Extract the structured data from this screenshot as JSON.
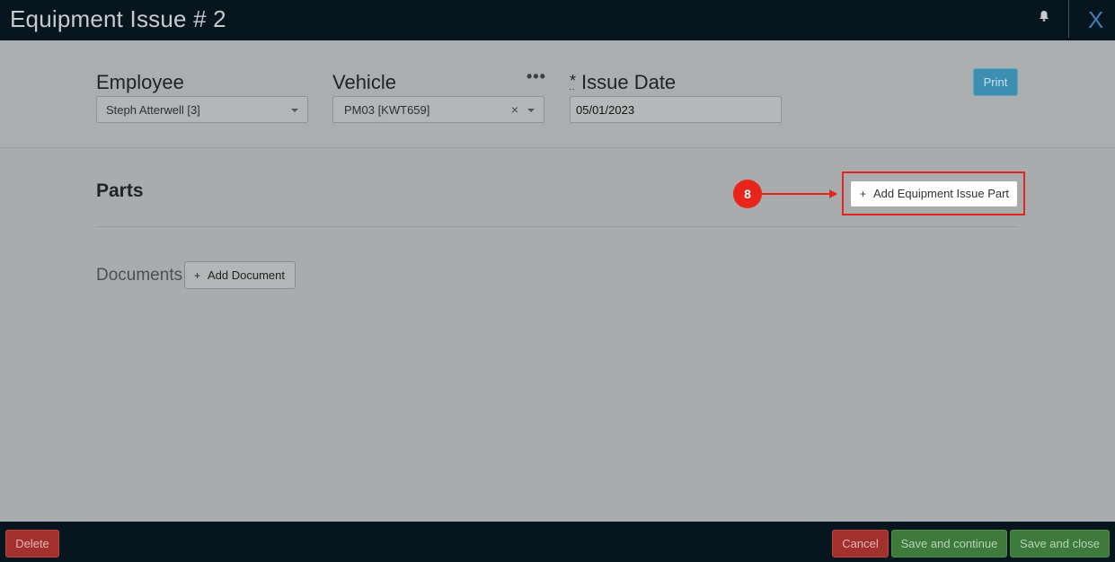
{
  "window": {
    "title": "Equipment Issue # 2",
    "close_label": "X"
  },
  "header": {
    "employee": {
      "label": "Employee",
      "value": "Steph Atterwell [3]"
    },
    "vehicle": {
      "label": "Vehicle",
      "value": "PM03 [KWT659]",
      "clear": "×",
      "more": "•••"
    },
    "issue_date": {
      "required_mark": "*",
      "label": "Issue Date",
      "value": "05/01/2023"
    },
    "print_label": "Print"
  },
  "parts": {
    "title": "Parts",
    "add_label": "Add Equipment Issue Part",
    "plus": "+"
  },
  "annotation": {
    "step": "8",
    "color": "#e0261f"
  },
  "documents": {
    "label": "Documents",
    "add_label": "Add Document",
    "plus": "+"
  },
  "footer": {
    "delete_label": "Delete",
    "cancel_label": "Cancel",
    "save_continue_label": "Save and continue",
    "save_close_label": "Save and close"
  },
  "colors": {
    "topbar": "#06151e",
    "print": "#3c8fb0",
    "danger": "#a2302d",
    "success": "#3d7a3b"
  },
  "icons": {
    "bell": "bell-icon",
    "close": "close-icon"
  }
}
